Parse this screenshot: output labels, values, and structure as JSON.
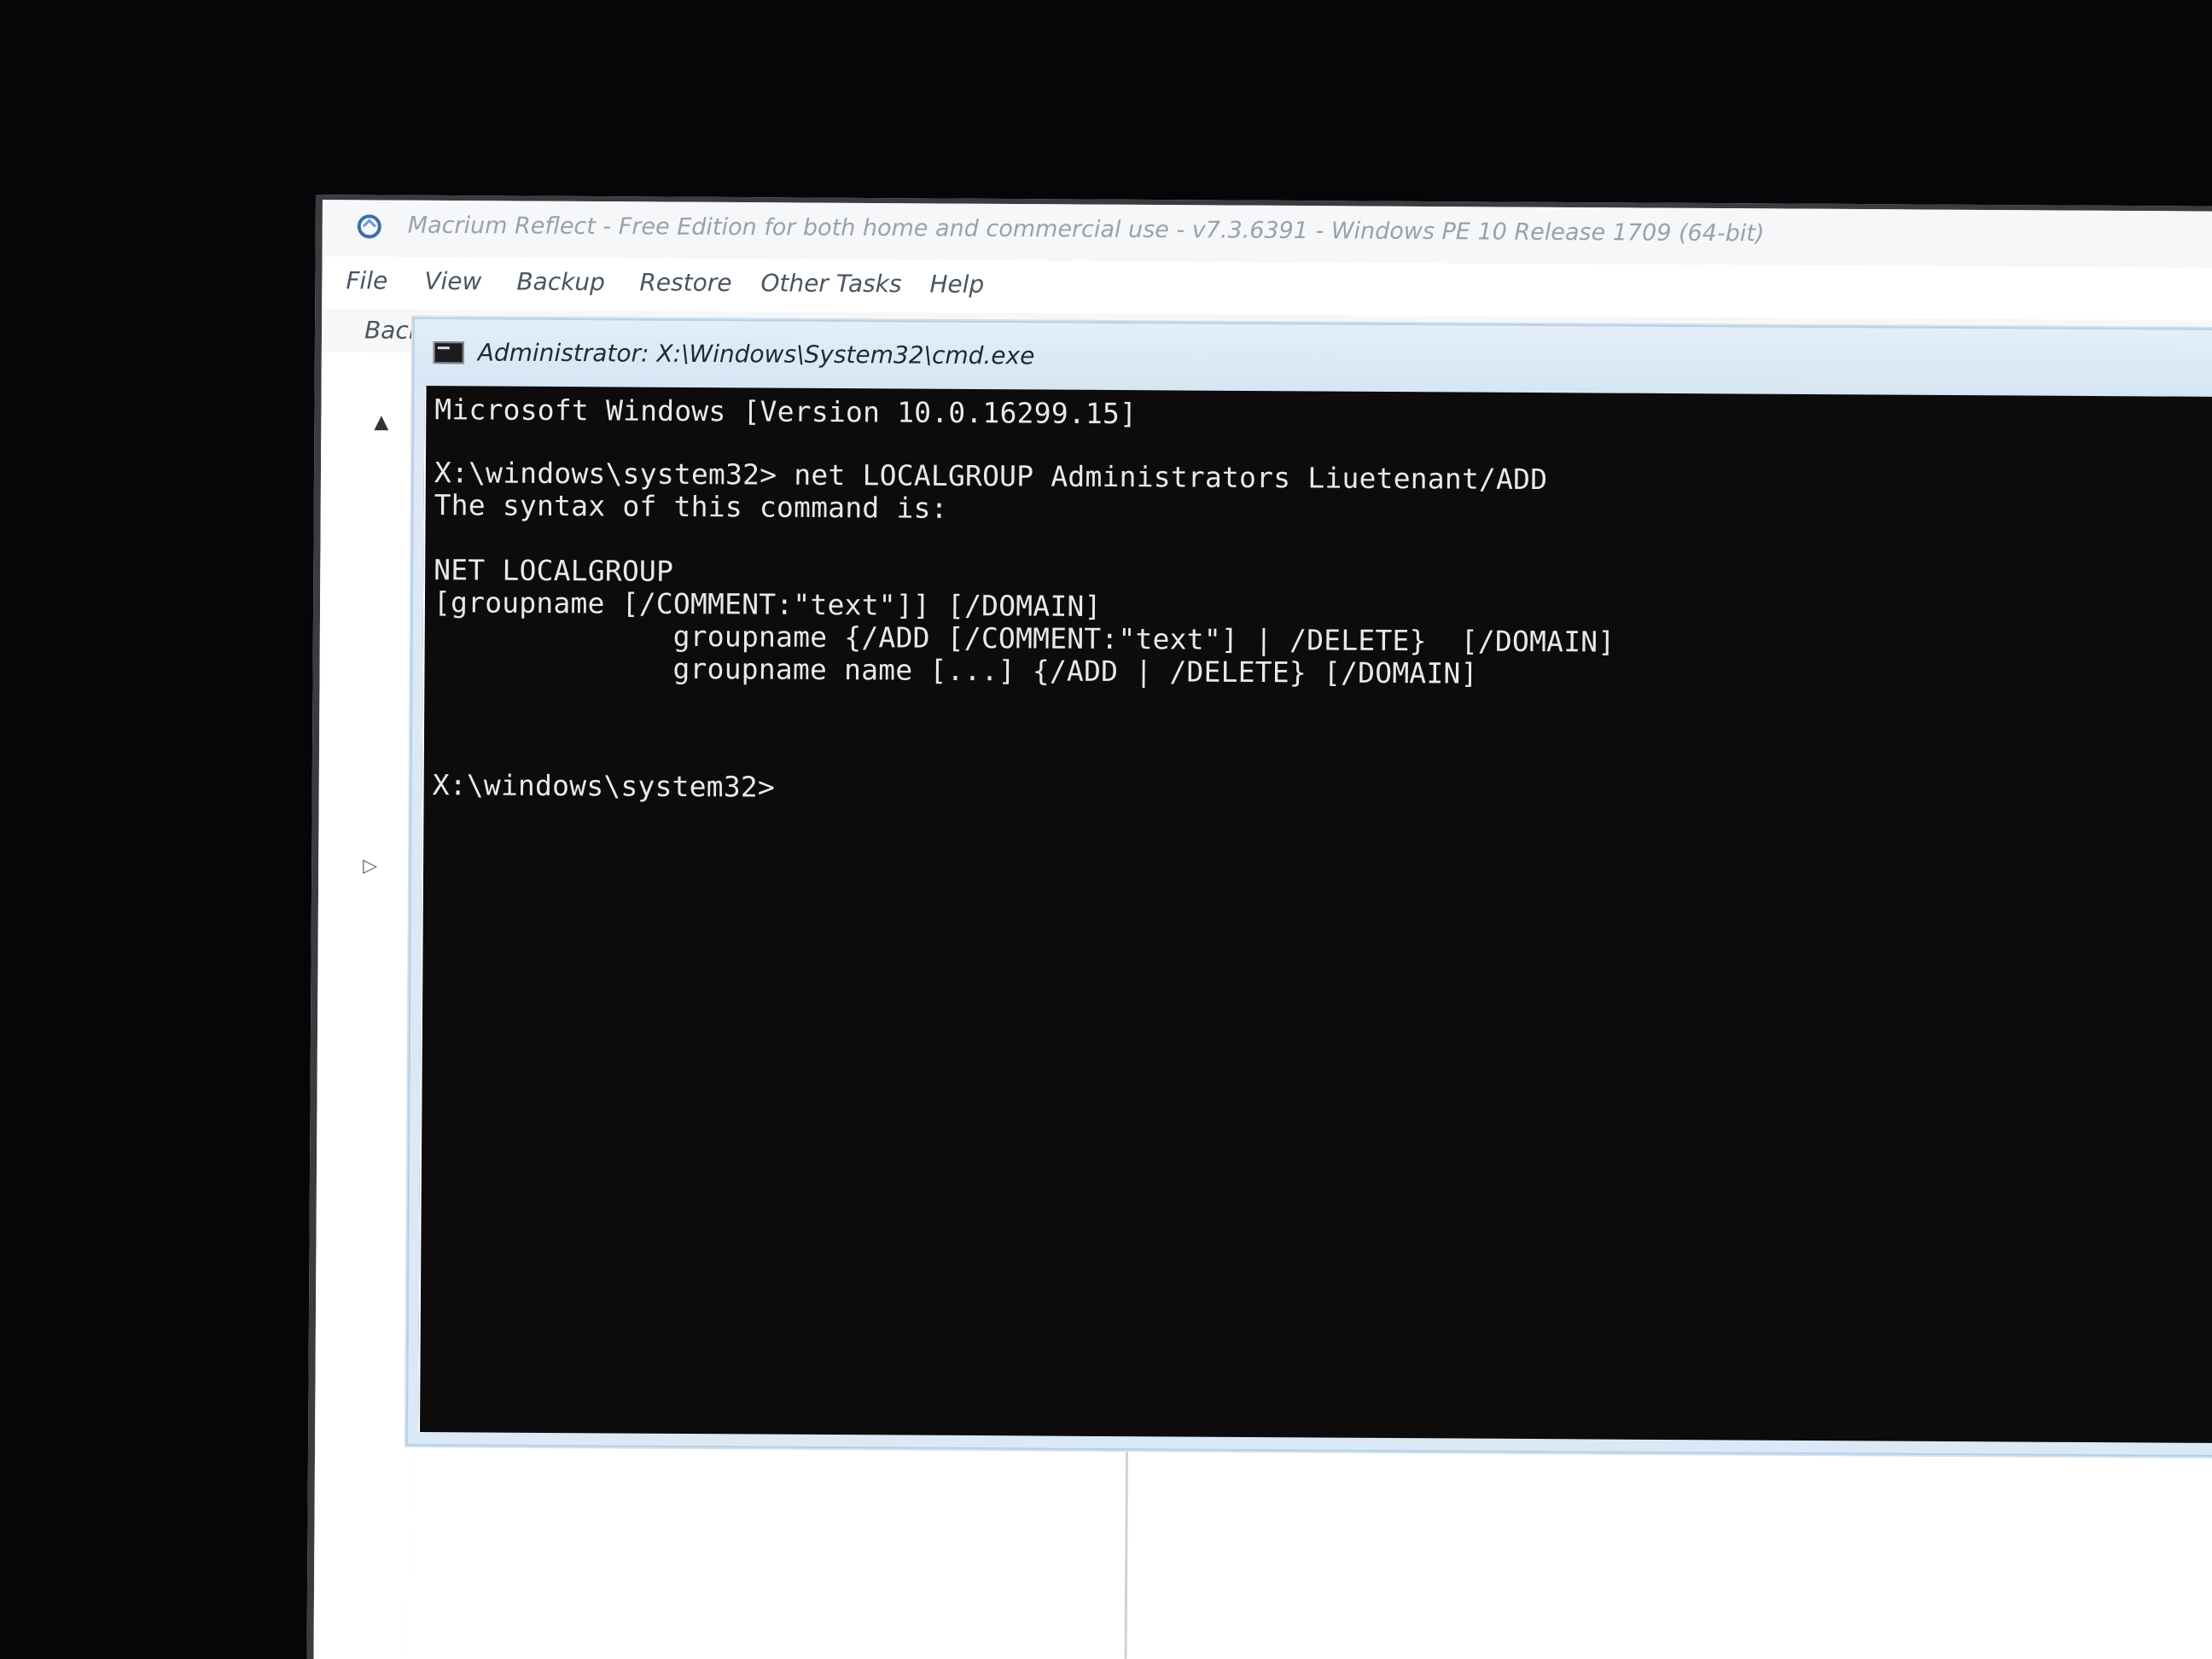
{
  "app": {
    "title": "Macrium Reflect - Free Edition for both home and commercial use - v7.3.6391 - Windows PE 10 Release 1709 (64-bit)",
    "icon": "macrium-reflect-icon",
    "menu": [
      "File",
      "View",
      "Backup",
      "Restore",
      "Other Tasks",
      "Help"
    ],
    "toolbar_label": "Back"
  },
  "cmd": {
    "title": "Administrator: X:\\Windows\\System32\\cmd.exe",
    "icon": "cmd-icon",
    "lines": [
      "Microsoft Windows [Version 10.0.16299.15]",
      "",
      "X:\\windows\\system32> net LOCALGROUP Administrators Liuetenant/ADD",
      "The syntax of this command is:",
      "",
      "NET LOCALGROUP",
      "[groupname [/COMMENT:\"text\"]] [/DOMAIN]",
      "              groupname {/ADD [/COMMENT:\"text\"] | /DELETE}  [/DOMAIN]",
      "              groupname name [...] {/ADD | /DELETE} [/DOMAIN]",
      "",
      "X:\\windows\\system32>"
    ]
  },
  "colors": {
    "console_bg": "#0d0b0b",
    "console_text": "#e9e9e9",
    "titlebar_bg": "#dbe9f6",
    "backdrop": "#050608"
  }
}
